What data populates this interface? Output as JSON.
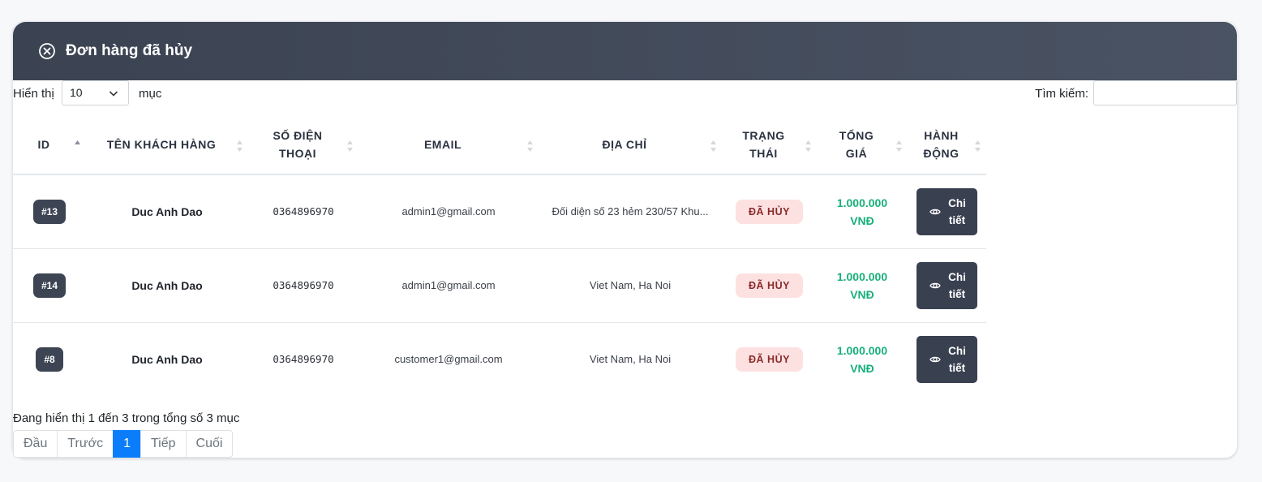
{
  "header": {
    "title": "Đơn hàng đã hủy",
    "icon": "circle-x-icon"
  },
  "toolbar": {
    "length_label": "Hiển thị",
    "length_value": "10",
    "length_suffix": "mục",
    "search_label": "Tìm kiếm:",
    "search_value": ""
  },
  "table": {
    "columns": [
      "ID",
      "TÊN KHÁCH HÀNG",
      "SỐ ĐIỆN THOẠI",
      "EMAIL",
      "ĐỊA CHỈ",
      "TRẠNG THÁI",
      "TỔNG GIÁ",
      "HÀNH ĐỘNG"
    ],
    "rows": [
      {
        "id": "#13",
        "customer": "Duc Anh Dao",
        "phone": "0364896970",
        "email": "admin1@gmail.com",
        "address": "Đối diện số 23 hẻm 230/57 Khu...",
        "status": "ĐÃ HỦY",
        "total": "1.000.000 VNĐ",
        "action": "Chi tiết"
      },
      {
        "id": "#14",
        "customer": "Duc Anh Dao",
        "phone": "0364896970",
        "email": "admin1@gmail.com",
        "address": "Viet Nam, Ha Noi",
        "status": "ĐÃ HỦY",
        "total": "1.000.000 VNĐ",
        "action": "Chi tiết"
      },
      {
        "id": "#8",
        "customer": "Duc Anh Dao",
        "phone": "0364896970",
        "email": "customer1@gmail.com",
        "address": "Viet Nam, Ha Noi",
        "status": "ĐÃ HỦY",
        "total": "1.000.000 VNĐ",
        "action": "Chi tiết"
      }
    ]
  },
  "footer": {
    "info": "Đang hiển thị 1 đến 3 trong tổng số 3 mục",
    "pagination": [
      "Đầu",
      "Trước",
      "1",
      "Tiếp",
      "Cuối"
    ],
    "active_page": "1"
  },
  "colors": {
    "header_bg": "#3b4352",
    "accent": "#0b7dfb",
    "total_green": "#18b07a",
    "status_bg": "#fde1e1"
  }
}
